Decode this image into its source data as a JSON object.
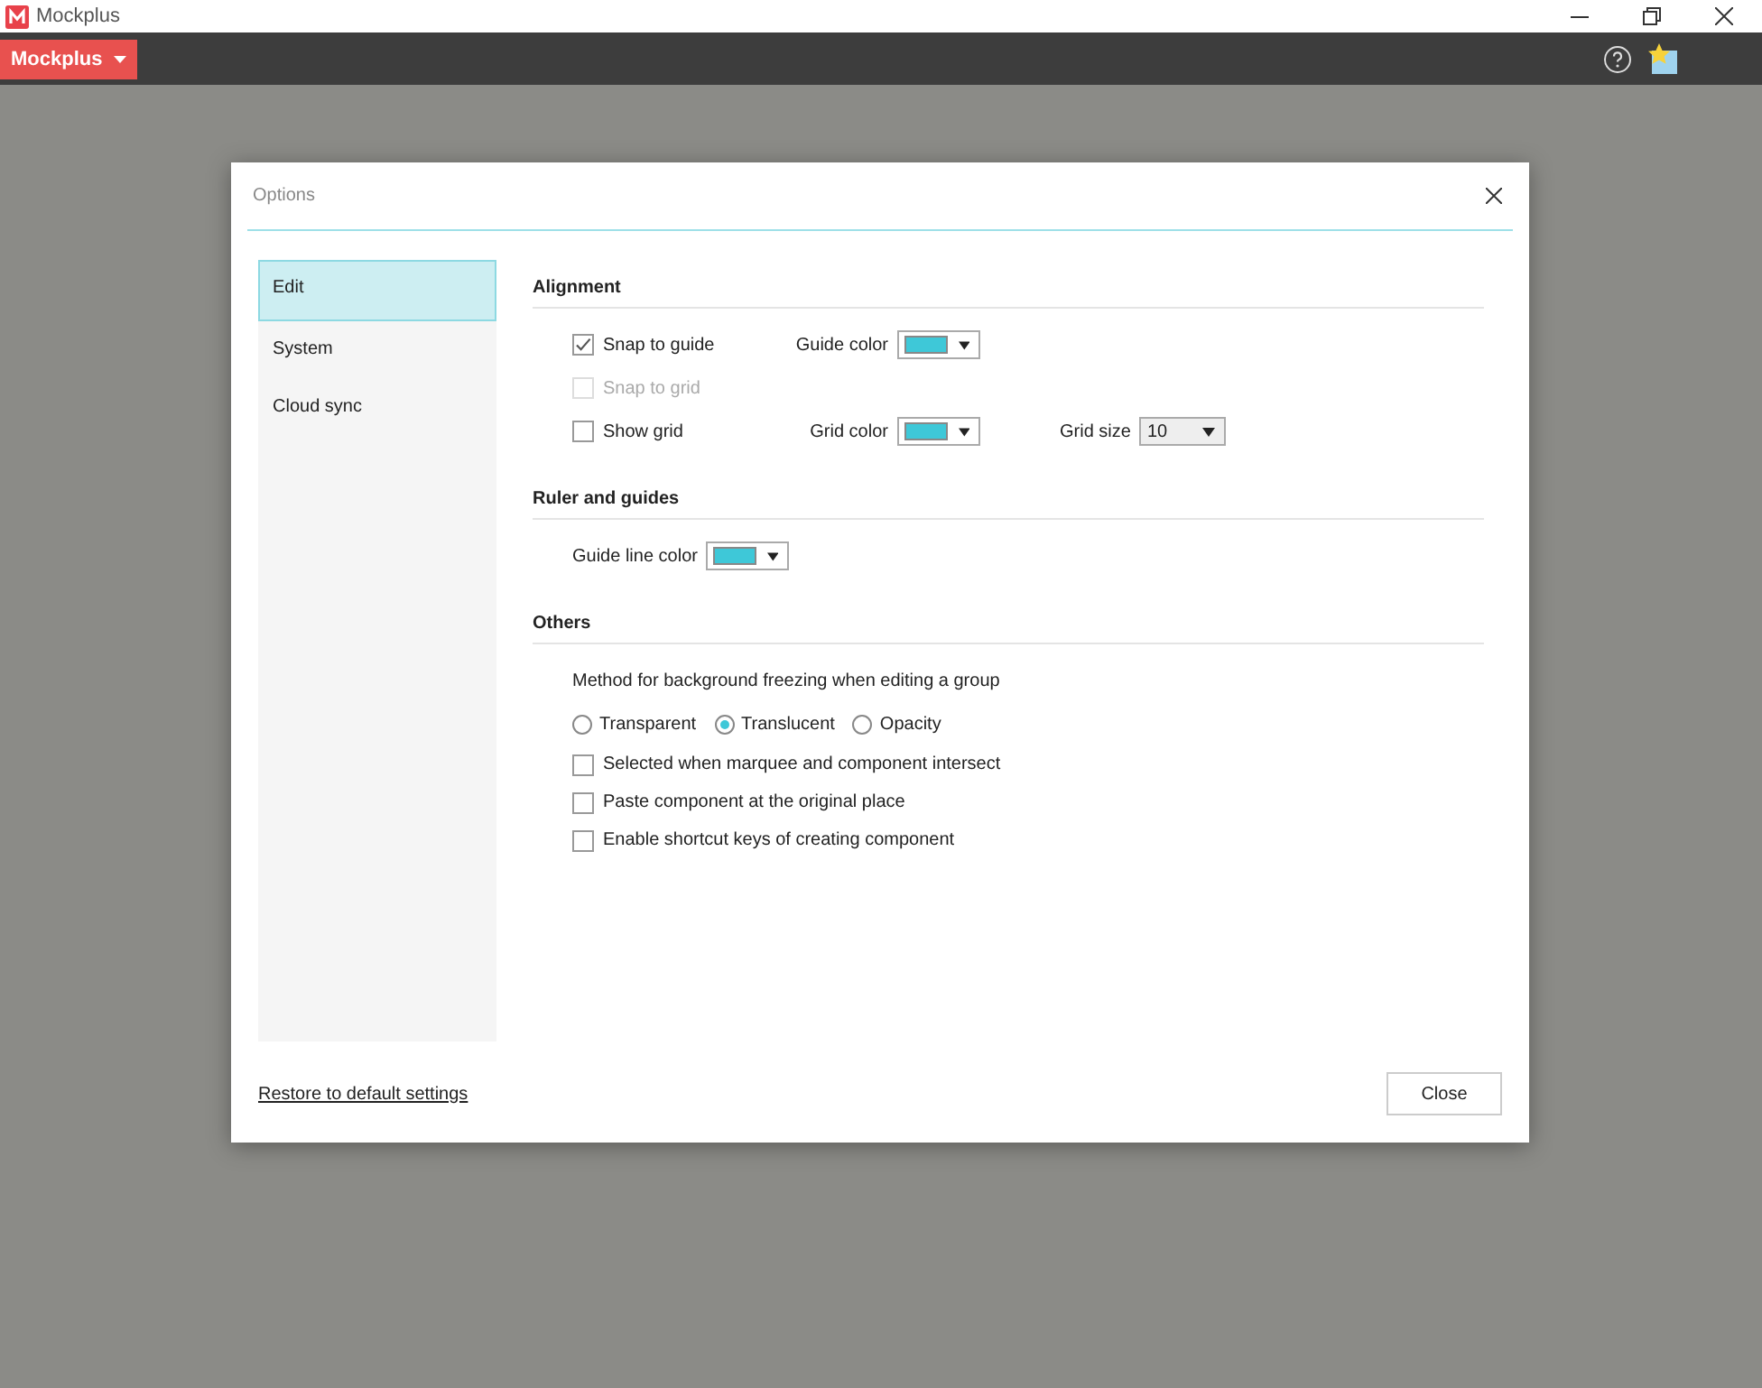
{
  "window": {
    "title": "Mockplus"
  },
  "toolbar": {
    "menu_button": "Mockplus"
  },
  "dialog": {
    "title": "Options",
    "sidebar": [
      {
        "label": "Edit",
        "selected": true
      },
      {
        "label": "System",
        "selected": false
      },
      {
        "label": "Cloud sync",
        "selected": false
      }
    ],
    "sections": [
      {
        "title": "Alignment",
        "rows": [
          {
            "kind": "checkbox",
            "label": "Snap to guide",
            "checked": true,
            "disabled": false,
            "extras": [
              {
                "kind": "color",
                "label": "Guide color",
                "color": "#3ec8d8"
              }
            ]
          },
          {
            "kind": "checkbox",
            "label": "Snap to grid",
            "checked": false,
            "disabled": true,
            "extras": []
          },
          {
            "kind": "checkbox",
            "label": "Show grid",
            "checked": false,
            "disabled": false,
            "extras": [
              {
                "kind": "color",
                "label": "Grid color",
                "color": "#3ec8d8"
              },
              {
                "kind": "select",
                "label": "Grid size",
                "value": "10"
              }
            ]
          }
        ]
      },
      {
        "title": "Ruler and guides",
        "rows": [
          {
            "kind": "color",
            "label": "Guide line color",
            "color": "#3ec8d8"
          }
        ]
      },
      {
        "title": "Others",
        "rows": [
          {
            "kind": "text",
            "label": "Method for background freezing when editing a group"
          },
          {
            "kind": "radios",
            "options": [
              {
                "label": "Transparent",
                "selected": false
              },
              {
                "label": "Translucent",
                "selected": true
              },
              {
                "label": "Opacity",
                "selected": false
              }
            ]
          },
          {
            "kind": "checkbox",
            "label": "Selected when marquee and component intersect",
            "checked": false,
            "disabled": false,
            "extras": []
          },
          {
            "kind": "checkbox",
            "label": "Paste component at the original place",
            "checked": false,
            "disabled": false,
            "extras": []
          },
          {
            "kind": "checkbox",
            "label": "Enable shortcut keys of creating component",
            "checked": false,
            "disabled": false,
            "extras": []
          }
        ]
      }
    ],
    "restore_link": "Restore to default settings",
    "close_button": "Close"
  }
}
